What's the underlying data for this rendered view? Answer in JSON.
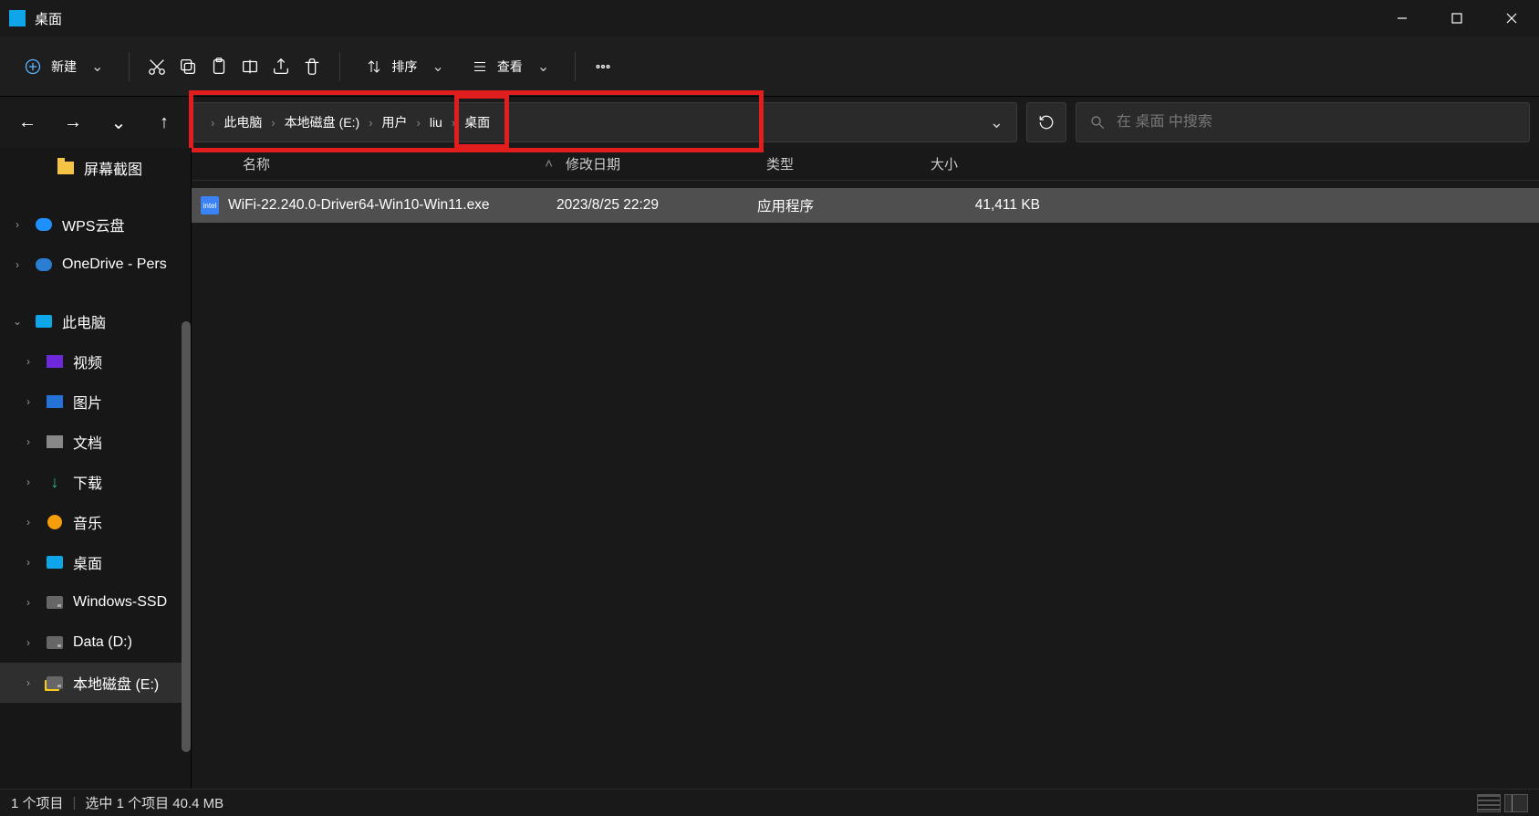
{
  "window": {
    "title": "桌面"
  },
  "toolbar": {
    "new_label": "新建",
    "sort_label": "排序",
    "view_label": "查看"
  },
  "breadcrumb": {
    "items": [
      "此电脑",
      "本地磁盘 (E:)",
      "用户",
      "liu",
      "桌面"
    ]
  },
  "search": {
    "placeholder": "在 桌面 中搜索"
  },
  "sidebar": {
    "items": [
      {
        "label": "屏幕截图",
        "type": "folder",
        "caret": "",
        "indent": 2
      },
      {
        "label": "WPS云盘",
        "type": "cloud-wps",
        "caret": ">",
        "indent": 0
      },
      {
        "label": "OneDrive - Pers",
        "type": "cloud-od",
        "caret": ">",
        "indent": 0
      },
      {
        "label": "此电脑",
        "type": "pc",
        "caret": "v",
        "indent": 0
      },
      {
        "label": "视频",
        "type": "video",
        "caret": ">",
        "indent": 1
      },
      {
        "label": "图片",
        "type": "pictures",
        "caret": ">",
        "indent": 1
      },
      {
        "label": "文档",
        "type": "docs",
        "caret": ">",
        "indent": 1
      },
      {
        "label": "下载",
        "type": "downloads",
        "caret": ">",
        "indent": 1
      },
      {
        "label": "音乐",
        "type": "music",
        "caret": ">",
        "indent": 1
      },
      {
        "label": "桌面",
        "type": "desktop",
        "caret": ">",
        "indent": 1
      },
      {
        "label": "Windows-SSD",
        "type": "disk",
        "caret": ">",
        "indent": 1
      },
      {
        "label": "Data (D:)",
        "type": "disk",
        "caret": ">",
        "indent": 1
      },
      {
        "label": "本地磁盘 (E:)",
        "type": "disk-warn",
        "caret": ">",
        "indent": 1,
        "active": true
      }
    ]
  },
  "columns": {
    "name": "名称",
    "date": "修改日期",
    "type": "类型",
    "size": "大小"
  },
  "files": [
    {
      "name": "WiFi-22.240.0-Driver64-Win10-Win11.exe",
      "date": "2023/8/25 22:29",
      "type": "应用程序",
      "size": "41,411 KB",
      "selected": true,
      "iconText": "intel"
    }
  ],
  "status": {
    "count": "1 个项目",
    "selection": "选中 1 个项目  40.4 MB"
  },
  "colors": {
    "accent": "#0ea5e9",
    "highlight": "#e11d1d"
  }
}
